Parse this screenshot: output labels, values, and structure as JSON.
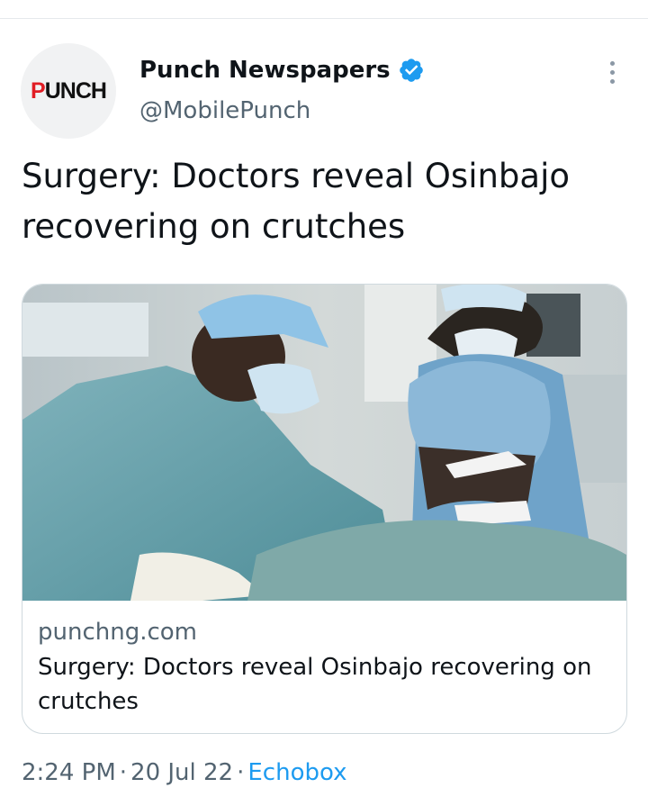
{
  "author": {
    "name": "Punch Newspapers",
    "handle": "@MobilePunch",
    "avatar_logo": "PUNCH",
    "verified": true
  },
  "tweet": {
    "text": "Surgery: Doctors reveal Osinbajo recovering on crutches"
  },
  "card": {
    "domain": "punchng.com",
    "title": "Surgery: Doctors reveal Osinbajo recovering on crutches",
    "image_description": "surgeons-in-operating-room"
  },
  "meta": {
    "time": "2:24 PM",
    "separator": "·",
    "date": "20 Jul 22",
    "source": "Echobox"
  },
  "icons": {
    "verified": "verified-badge-icon",
    "more": "more-options-icon"
  },
  "colors": {
    "accent": "#1d9bf0",
    "secondary_text": "#536471",
    "primary_text": "#0f1419",
    "punch_red": "#e11d24"
  }
}
